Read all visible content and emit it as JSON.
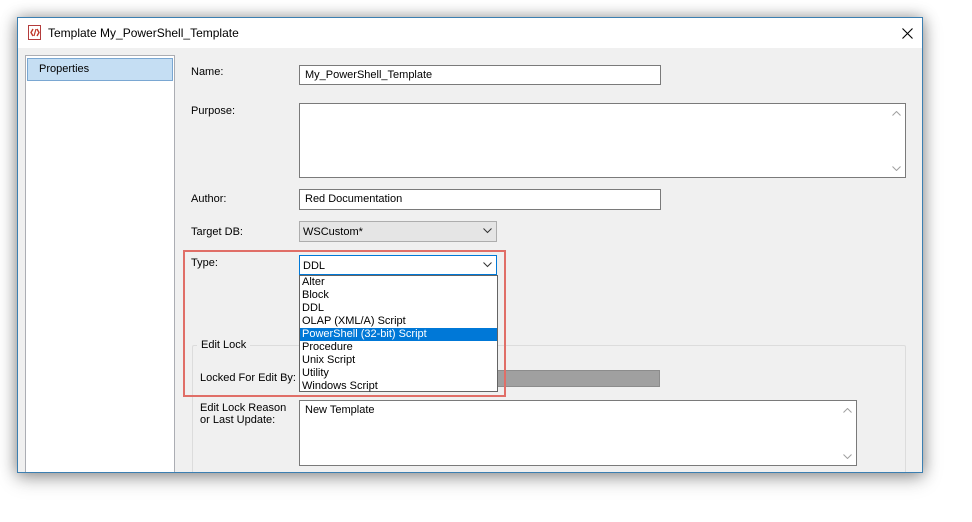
{
  "window": {
    "title": "Template My_PowerShell_Template"
  },
  "sidebar": {
    "items": [
      {
        "label": "Properties"
      }
    ]
  },
  "form": {
    "name_label": "Name:",
    "name_value": "My_PowerShell_Template",
    "purpose_label": "Purpose:",
    "purpose_value": "",
    "author_label": "Author:",
    "author_value": "Red Documentation",
    "target_db_label": "Target DB:",
    "target_db_value": "WSCustom*",
    "type_label": "Type:",
    "type_value": "DDL",
    "type_options": [
      {
        "label": "Alter",
        "selected": false
      },
      {
        "label": "Block",
        "selected": false
      },
      {
        "label": "DDL",
        "selected": false
      },
      {
        "label": "OLAP (XML/A) Script",
        "selected": false
      },
      {
        "label": "PowerShell (32-bit) Script",
        "selected": true
      },
      {
        "label": "Procedure",
        "selected": false
      },
      {
        "label": "Unix Script",
        "selected": false
      },
      {
        "label": "Utility",
        "selected": false
      },
      {
        "label": "Windows Script",
        "selected": false
      }
    ]
  },
  "edit_lock": {
    "group_title": "Edit Lock",
    "locked_for_label": "Locked For Edit By:",
    "reason_label_line1": "Edit Lock Reason",
    "reason_label_line2": "or Last Update:",
    "reason_value": "New Template"
  },
  "colors": {
    "selection": "#0078d7",
    "highlight_annotation": "#e06e67",
    "sidebar_selected": "#c5def3"
  }
}
